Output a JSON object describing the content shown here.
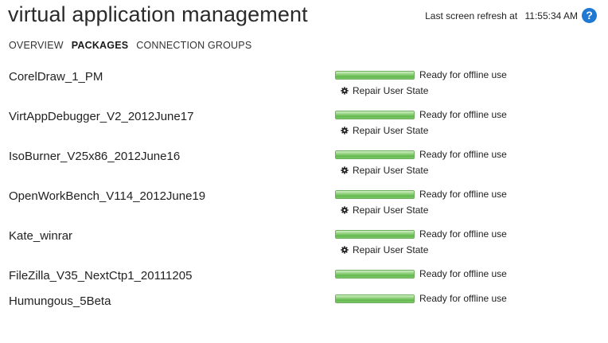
{
  "header": {
    "title": "virtual application management",
    "refresh_label": "Last screen refresh at",
    "refresh_time": "11:55:34 AM",
    "help_symbol": "?"
  },
  "nav": {
    "tabs": [
      {
        "label": "OVERVIEW",
        "active": false
      },
      {
        "label": "PACKAGES",
        "active": true
      },
      {
        "label": "CONNECTION GROUPS",
        "active": false
      }
    ]
  },
  "packages": [
    {
      "name": "CorelDraw_1_PM",
      "status": "Ready for offline use",
      "progress": 1.0,
      "repair_label": "Repair User State"
    },
    {
      "name": "VirtAppDebugger_V2_2012June17",
      "status": "Ready for offline use",
      "progress": 1.0,
      "repair_label": "Repair User State"
    },
    {
      "name": "IsoBurner_V25x86_2012June16",
      "status": "Ready for offline use",
      "progress": 1.0,
      "repair_label": "Repair User State"
    },
    {
      "name": "OpenWorkBench_V114_2012June19",
      "status": "Ready for offline use",
      "progress": 1.0,
      "repair_label": "Repair User State"
    },
    {
      "name": "Kate_winrar",
      "status": "Ready for offline use",
      "progress": 1.0,
      "repair_label": "Repair User State"
    },
    {
      "name": "FileZilla_V35_NextCtp1_20111205",
      "status": "Ready for offline use",
      "progress": 1.0
    },
    {
      "name": "Humungous_5Beta",
      "status": "Ready for offline use",
      "progress": 1.0
    }
  ],
  "icons": {
    "help": "help-icon",
    "repair": "gear-icon"
  },
  "colors": {
    "accent": "#1f78d1",
    "progress_green": "#63b84f"
  }
}
